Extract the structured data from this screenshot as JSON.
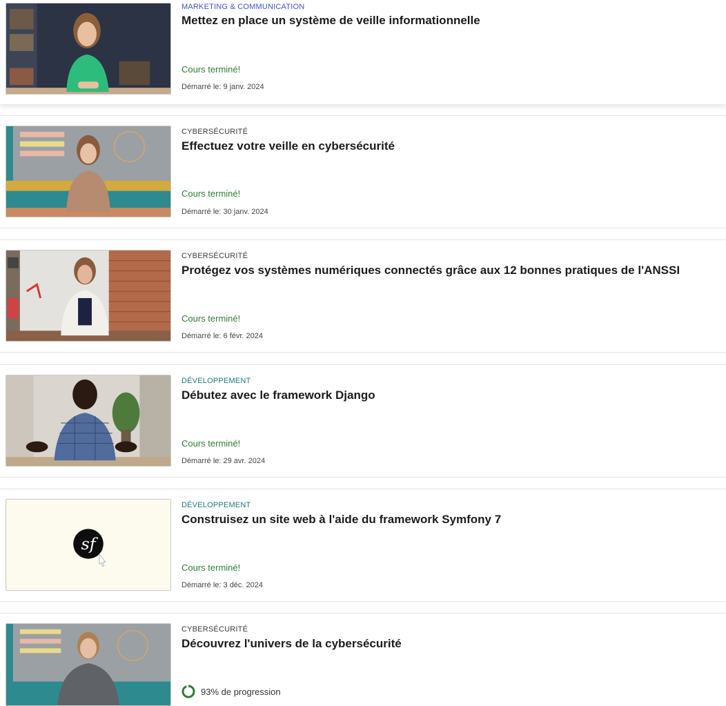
{
  "courses": [
    {
      "category": "MARKETING & COMMUNICATION",
      "category_color": "#3f4fd8",
      "title": "Mettez en place un système de veille informationnelle",
      "status": "Cours terminé!",
      "started": "Démarré le: 9 janv. 2024"
    },
    {
      "category": "CYBERSÉCURITÉ",
      "category_color": "#3a3a3a",
      "title": "Effectuez votre veille en cybersécurité",
      "status": "Cours terminé!",
      "started": "Démarré le: 30 janv. 2024"
    },
    {
      "category": "CYBERSÉCURITÉ",
      "category_color": "#3a3a3a",
      "title": "Protégez vos systèmes numériques connectés grâce aux 12 bonnes pratiques de l'ANSSI",
      "status": "Cours terminé!",
      "started": "Démarré le: 6 févr. 2024"
    },
    {
      "category": "DÉVELOPPEMENT",
      "category_color": "#1a7a7a",
      "title": "Débutez avec le framework Django",
      "status": "Cours terminé!",
      "started": "Démarré le: 29 avr. 2024"
    },
    {
      "category": "DÉVELOPPEMENT",
      "category_color": "#1a7a7a",
      "title": "Construisez un site web à l'aide du framework Symfony 7",
      "status": "Cours terminé!",
      "started": "Démarré le: 3 déc. 2024"
    },
    {
      "category": "CYBERSÉCURITÉ",
      "category_color": "#3a3a3a",
      "title": "Découvrez l'univers de la cybersécurité",
      "progress_label": "93% de progression",
      "progress_value": 0.93
    }
  ],
  "colors": {
    "completed_green": "#2e7d32",
    "progress_ring": "#2e7d32"
  }
}
